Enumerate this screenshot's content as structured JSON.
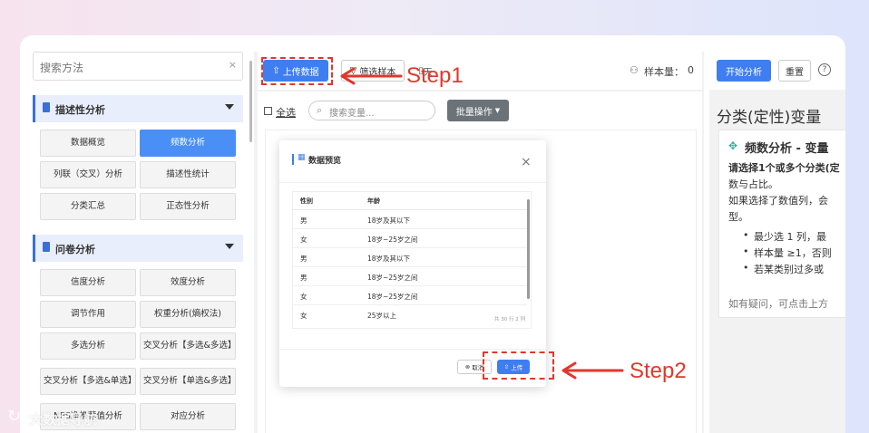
{
  "left": {
    "search_placeholder": "搜索方法",
    "search_clear": "×",
    "section1": {
      "title": "描述性分析",
      "items": [
        "数据概览",
        "频数分析",
        "列联（交叉）分析",
        "描述性统计",
        "分类汇总",
        "正态性分析"
      ]
    },
    "section2": {
      "title": "问卷分析",
      "items": [
        "信度分析",
        "效度分析",
        "调节作用",
        "权重分析(熵权法)",
        "多选分析",
        "交叉分析【多选&多选】",
        "交叉分析【多选&单选】",
        "交叉分析【单选&多选】",
        "NPS净推荐值分析",
        "对应分析"
      ]
    }
  },
  "toolbar": {
    "upload": "上传数据",
    "filter": "筛选样本",
    "more": "天",
    "sample_label": "样本量：",
    "sample_value": "0",
    "start": "开始分析",
    "reset": "重置",
    "help": "?"
  },
  "variables": {
    "select_all": "全选",
    "search_placeholder": "搜索变量...",
    "batch": "批量操作"
  },
  "dialog": {
    "title": "数据预览",
    "close": "×",
    "columns": [
      "性别",
      "年龄"
    ],
    "rows": [
      [
        "男",
        "18岁及其以下"
      ],
      [
        "女",
        "18岁~25岁之间"
      ],
      [
        "男",
        "18岁及其以下"
      ],
      [
        "男",
        "18岁~25岁之间"
      ],
      [
        "女",
        "18岁~25岁之间"
      ],
      [
        "女",
        "25岁以上"
      ]
    ],
    "footer": "共 30 行 2 列",
    "cancel": "取消",
    "upload": "上传"
  },
  "right": {
    "heading": "分类(定性)变量",
    "title": "频数分析 - 变量",
    "desc_bold": "请选择1个或多个分类(定",
    "desc1": "数与占比。",
    "desc2": "如果选择了数值列，会",
    "desc3": "型。",
    "bullets": [
      "最少选 1 列，最",
      "样本量 ≥1，否则",
      "若某类别过多或"
    ],
    "footer": "如有疑问，可点击上方"
  },
  "annotations": {
    "step1": "Step1",
    "step2": "Step2"
  },
  "watermark": "大数据导航",
  "colors": {
    "accent": "#3f7ef0",
    "annotation": "#e0382b",
    "section_bg": "#e8eefc"
  }
}
